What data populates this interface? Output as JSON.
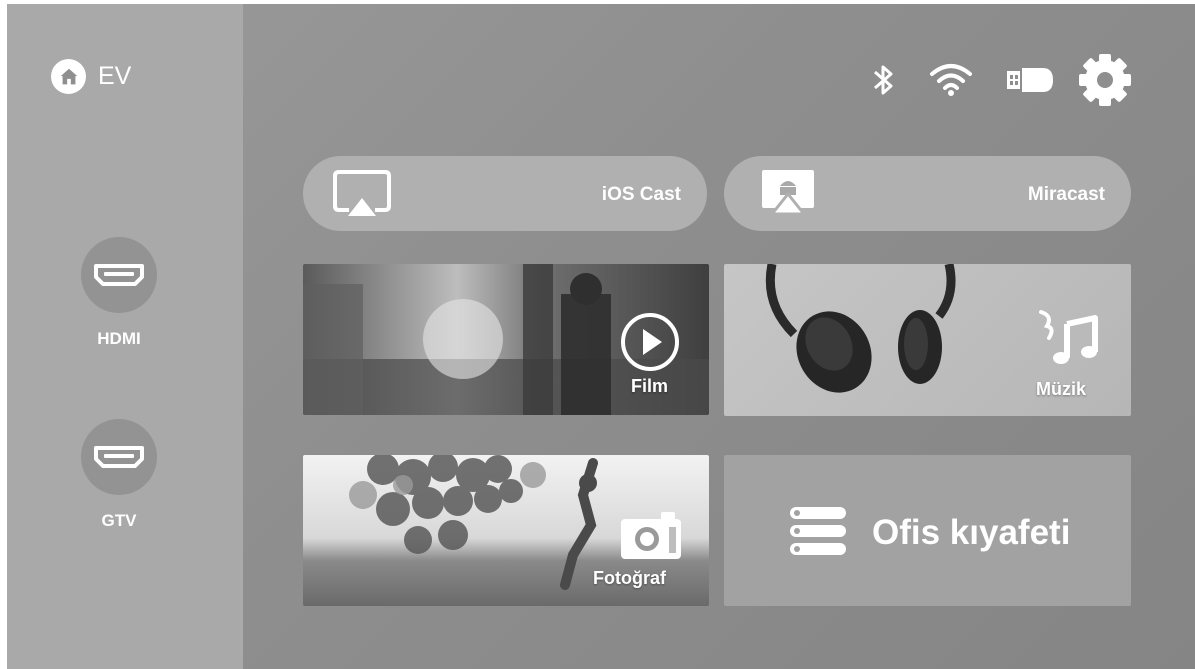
{
  "sidebar": {
    "home_label": "EV",
    "sources": [
      {
        "label": "HDMI",
        "icon": "hdmi-port-icon"
      },
      {
        "label": "GTV",
        "icon": "hdmi-port-icon"
      }
    ]
  },
  "status_bar": {
    "icons": [
      "bluetooth-icon",
      "wifi-icon",
      "usb-drive-icon",
      "settings-gear-icon"
    ]
  },
  "cast": {
    "ios_label": "iOS Cast",
    "miracast_label": "Miracast"
  },
  "tiles": {
    "film_label": "Film",
    "music_label": "Müzik",
    "photo_label": "Fotoğraf",
    "office_label": "Ofis kıyafeti"
  },
  "colors": {
    "screen_bg": "#8f8f8f",
    "sidebar_bg": "#a9a9a9",
    "pill_bg": "#b0b0b0",
    "office_tile_bg": "#a2a2a2",
    "text": "#ffffff"
  }
}
